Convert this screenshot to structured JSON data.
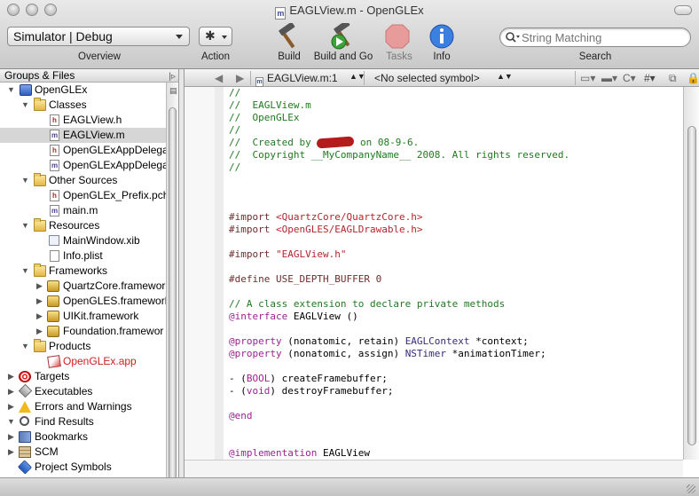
{
  "window": {
    "title": "EAGLView.m - OpenGLEx",
    "title_icon": "m"
  },
  "toolbar": {
    "scheme_value": "Simulator | Debug",
    "action_glyph": "✱",
    "overview_label": "Overview",
    "action_label": "Action",
    "build_label": "Build",
    "build_and_go_label": "Build and Go",
    "tasks_label": "Tasks",
    "info_label": "Info",
    "search_label": "Search",
    "search_placeholder": "String Matching"
  },
  "sidebar": {
    "header": "Groups & Files",
    "items": [
      {
        "label": "OpenGLEx",
        "icon": "project-icon"
      },
      {
        "label": "Classes",
        "icon": "folder-icon"
      },
      {
        "label": "EAGLView.h",
        "icon": "header-file-icon"
      },
      {
        "label": "EAGLView.m",
        "icon": "implementation-file-icon"
      },
      {
        "label": "OpenGLExAppDelegat",
        "icon": "header-file-icon"
      },
      {
        "label": "OpenGLExAppDelegat",
        "icon": "implementation-file-icon"
      },
      {
        "label": "Other Sources",
        "icon": "folder-icon"
      },
      {
        "label": "OpenGLEx_Prefix.pch",
        "icon": "header-file-icon"
      },
      {
        "label": "main.m",
        "icon": "implementation-file-icon"
      },
      {
        "label": "Resources",
        "icon": "folder-icon"
      },
      {
        "label": "MainWindow.xib",
        "icon": "xib-file-icon"
      },
      {
        "label": "Info.plist",
        "icon": "plist-file-icon"
      },
      {
        "label": "Frameworks",
        "icon": "folder-icon"
      },
      {
        "label": "QuartzCore.framewor",
        "icon": "framework-icon"
      },
      {
        "label": "OpenGLES.framework",
        "icon": "framework-icon"
      },
      {
        "label": "UIKit.framework",
        "icon": "framework-icon"
      },
      {
        "label": "Foundation.framewor",
        "icon": "framework-icon"
      },
      {
        "label": "Products",
        "icon": "folder-icon"
      },
      {
        "label": "OpenGLEx.app",
        "icon": "app-product-icon"
      },
      {
        "label": "Targets",
        "icon": "target-icon"
      },
      {
        "label": "Executables",
        "icon": "executable-icon"
      },
      {
        "label": "Errors and Warnings",
        "icon": "warning-icon"
      },
      {
        "label": "Find Results",
        "icon": "find-icon"
      },
      {
        "label": "Bookmarks",
        "icon": "bookmark-icon"
      },
      {
        "label": "SCM",
        "icon": "scm-icon"
      },
      {
        "label": "Project Symbols",
        "icon": "symbols-icon"
      }
    ]
  },
  "editor": {
    "file_popup": "EAGLView.m:1",
    "symbol_popup": "<No selected symbol>",
    "code": {
      "l1": "//",
      "l2": "//  EAGLView.m",
      "l3": "//  OpenGLEx",
      "l4": "//",
      "l5a": "//  Created by ",
      "l5b": " on 08-9-6.",
      "l6": "//  Copyright __MyCompanyName__ 2008. All rights reserved.",
      "l7": "//",
      "imp1_kw": "#import ",
      "imp1_val": "<QuartzCore/QuartzCore.h>",
      "imp2_kw": "#import ",
      "imp2_val": "<OpenGLES/EAGLDrawable.h>",
      "imp3_kw": "#import ",
      "imp3_val": "\"EAGLView.h\"",
      "define": "#define USE_DEPTH_BUFFER 0",
      "comment_ext": "// A class extension to declare private methods",
      "iface_kw": "@interface",
      "iface_rest": " EAGLView ()",
      "prop1_kw": "@property",
      "prop1_mid": " (nonatomic, retain) ",
      "prop1_type": "EAGLContext",
      "prop1_rest": " *context;",
      "prop2_kw": "@property",
      "prop2_mid": " (nonatomic, assign) ",
      "prop2_type": "NSTimer",
      "prop2_rest": " *animationTimer;",
      "m1_a": "- (",
      "m1_type": "BOOL",
      "m1_b": ") createFramebuffer;",
      "m2_a": "- (",
      "m2_type": "void",
      "m2_b": ") destroyFramebuffer;",
      "end_kw": "@end",
      "impl_kw": "@implementation",
      "impl_rest": " EAGLView"
    }
  }
}
